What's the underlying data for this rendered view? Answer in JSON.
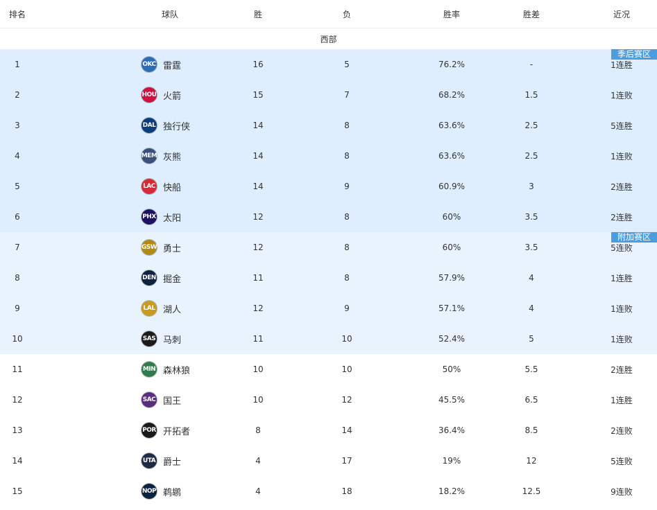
{
  "headers": {
    "rank": "排名",
    "team": "球队",
    "wins": "胜",
    "losses": "负",
    "pct": "胜率",
    "gb": "胜差",
    "streak": "近况"
  },
  "conference": "西部",
  "tags": {
    "playoff": "季后赛区",
    "playin": "附加赛区"
  },
  "colors": {
    "playoff_bg": "#dfeeff",
    "playin_bg": "#e8f3fe",
    "tag_bg": "#4d9cde"
  },
  "rows": [
    {
      "rank": "1",
      "abbr": "OKC",
      "team": "雷霆",
      "w": "16",
      "l": "5",
      "pct": "76.2%",
      "gb": "-",
      "streak": "1连胜",
      "zone": "playoff",
      "logo_color": "#2d6db5"
    },
    {
      "rank": "2",
      "abbr": "HOU",
      "team": "火箭",
      "w": "15",
      "l": "7",
      "pct": "68.2%",
      "gb": "1.5",
      "streak": "1连败",
      "zone": "playoff",
      "logo_color": "#ce1141"
    },
    {
      "rank": "3",
      "abbr": "DAL",
      "team": "独行侠",
      "w": "14",
      "l": "8",
      "pct": "63.6%",
      "gb": "2.5",
      "streak": "5连胜",
      "zone": "playoff",
      "logo_color": "#0b3d7a"
    },
    {
      "rank": "4",
      "abbr": "MEM",
      "team": "灰熊",
      "w": "14",
      "l": "8",
      "pct": "63.6%",
      "gb": "2.5",
      "streak": "1连败",
      "zone": "playoff",
      "logo_color": "#3a4f7a"
    },
    {
      "rank": "5",
      "abbr": "LAC",
      "team": "快船",
      "w": "14",
      "l": "9",
      "pct": "60.9%",
      "gb": "3",
      "streak": "2连胜",
      "zone": "playoff",
      "logo_color": "#d62a35"
    },
    {
      "rank": "6",
      "abbr": "PHX",
      "team": "太阳",
      "w": "12",
      "l": "8",
      "pct": "60%",
      "gb": "3.5",
      "streak": "2连胜",
      "zone": "playoff",
      "logo_color": "#1d1160"
    },
    {
      "rank": "7",
      "abbr": "GSW",
      "team": "勇士",
      "w": "12",
      "l": "8",
      "pct": "60%",
      "gb": "3.5",
      "streak": "5连败",
      "zone": "playin",
      "logo_color": "#b38a10"
    },
    {
      "rank": "8",
      "abbr": "DEN",
      "team": "掘金",
      "w": "11",
      "l": "8",
      "pct": "57.9%",
      "gb": "4",
      "streak": "1连胜",
      "zone": "playin",
      "logo_color": "#0e2240"
    },
    {
      "rank": "9",
      "abbr": "LAL",
      "team": "湖人",
      "w": "12",
      "l": "9",
      "pct": "57.1%",
      "gb": "4",
      "streak": "1连败",
      "zone": "playin",
      "logo_color": "#c99a1c"
    },
    {
      "rank": "10",
      "abbr": "SAS",
      "team": "马刺",
      "w": "11",
      "l": "10",
      "pct": "52.4%",
      "gb": "5",
      "streak": "1连败",
      "zone": "playin",
      "logo_color": "#1a1a1a"
    },
    {
      "rank": "11",
      "abbr": "MIN",
      "team": "森林狼",
      "w": "10",
      "l": "10",
      "pct": "50%",
      "gb": "5.5",
      "streak": "2连胜",
      "zone": "other",
      "logo_color": "#2f7d4f"
    },
    {
      "rank": "12",
      "abbr": "SAC",
      "team": "国王",
      "w": "10",
      "l": "12",
      "pct": "45.5%",
      "gb": "6.5",
      "streak": "1连胜",
      "zone": "other",
      "logo_color": "#5a2d81"
    },
    {
      "rank": "13",
      "abbr": "POR",
      "team": "开拓者",
      "w": "8",
      "l": "14",
      "pct": "36.4%",
      "gb": "8.5",
      "streak": "2连败",
      "zone": "other",
      "logo_color": "#1a1a1a"
    },
    {
      "rank": "14",
      "abbr": "UTA",
      "team": "爵士",
      "w": "4",
      "l": "17",
      "pct": "19%",
      "gb": "12",
      "streak": "5连败",
      "zone": "other",
      "logo_color": "#1f2a44"
    },
    {
      "rank": "15",
      "abbr": "NOP",
      "team": "鹈鹕",
      "w": "4",
      "l": "18",
      "pct": "18.2%",
      "gb": "12.5",
      "streak": "9连败",
      "zone": "other",
      "logo_color": "#0c2340"
    }
  ]
}
